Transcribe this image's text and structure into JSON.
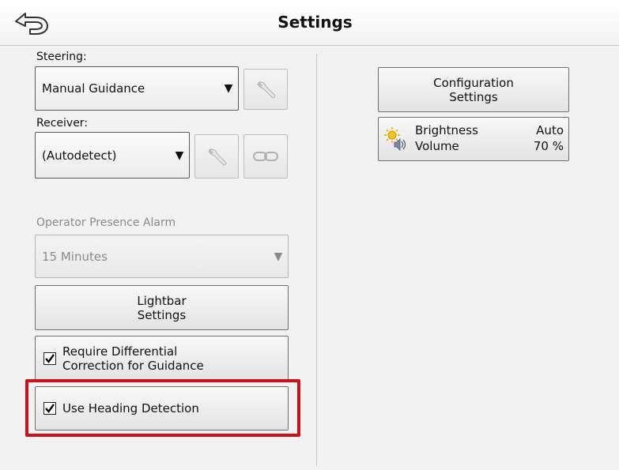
{
  "header": {
    "title": "Settings",
    "back_icon": "back-arrow-icon"
  },
  "steering": {
    "label": "Steering:",
    "value": "Manual Guidance"
  },
  "receiver": {
    "label": "Receiver:",
    "value": "(Autodetect)"
  },
  "operator_presence": {
    "label": "Operator Presence Alarm",
    "value": "15 Minutes"
  },
  "lightbar": {
    "line1": "Lightbar",
    "line2": "Settings"
  },
  "differential": {
    "line1": "Require Differential",
    "line2": "Correction for Guidance",
    "checked": true
  },
  "heading": {
    "label": "Use Heading Detection",
    "checked": true
  },
  "configuration": {
    "line1": "Configuration",
    "line2": "Settings"
  },
  "brightness_volume": {
    "brightness_label": "Brightness",
    "brightness_value": "Auto",
    "volume_label": "Volume",
    "volume_value": "70 %"
  },
  "colors": {
    "highlight": "#c8121c"
  }
}
